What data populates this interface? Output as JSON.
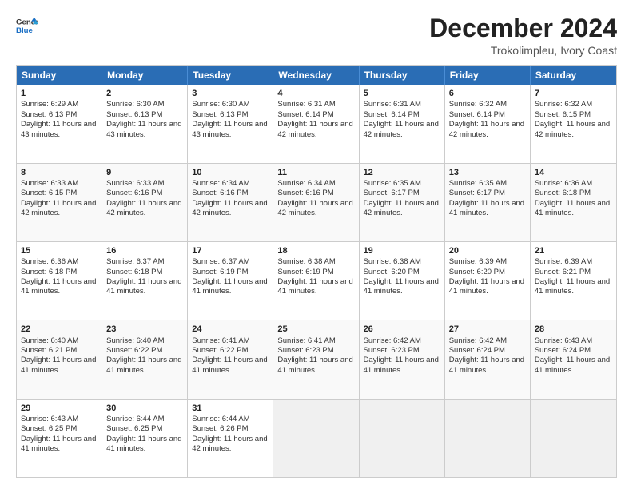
{
  "header": {
    "logo_line1": "General",
    "logo_line2": "Blue",
    "main_title": "December 2024",
    "subtitle": "Trokolimpleu, Ivory Coast"
  },
  "calendar": {
    "days_of_week": [
      "Sunday",
      "Monday",
      "Tuesday",
      "Wednesday",
      "Thursday",
      "Friday",
      "Saturday"
    ],
    "weeks": [
      [
        {
          "day": "",
          "empty": true
        },
        {
          "day": "",
          "empty": true
        },
        {
          "day": "",
          "empty": true
        },
        {
          "day": "",
          "empty": true
        },
        {
          "day": "",
          "empty": true
        },
        {
          "day": "",
          "empty": true
        },
        {
          "day": "",
          "empty": true
        }
      ],
      [
        {
          "day": "1",
          "sunrise": "Sunrise: 6:29 AM",
          "sunset": "Sunset: 6:13 PM",
          "daylight": "Daylight: 11 hours and 43 minutes."
        },
        {
          "day": "2",
          "sunrise": "Sunrise: 6:30 AM",
          "sunset": "Sunset: 6:13 PM",
          "daylight": "Daylight: 11 hours and 43 minutes."
        },
        {
          "day": "3",
          "sunrise": "Sunrise: 6:30 AM",
          "sunset": "Sunset: 6:13 PM",
          "daylight": "Daylight: 11 hours and 43 minutes."
        },
        {
          "day": "4",
          "sunrise": "Sunrise: 6:31 AM",
          "sunset": "Sunset: 6:14 PM",
          "daylight": "Daylight: 11 hours and 42 minutes."
        },
        {
          "day": "5",
          "sunrise": "Sunrise: 6:31 AM",
          "sunset": "Sunset: 6:14 PM",
          "daylight": "Daylight: 11 hours and 42 minutes."
        },
        {
          "day": "6",
          "sunrise": "Sunrise: 6:32 AM",
          "sunset": "Sunset: 6:14 PM",
          "daylight": "Daylight: 11 hours and 42 minutes."
        },
        {
          "day": "7",
          "sunrise": "Sunrise: 6:32 AM",
          "sunset": "Sunset: 6:15 PM",
          "daylight": "Daylight: 11 hours and 42 minutes."
        }
      ],
      [
        {
          "day": "8",
          "sunrise": "Sunrise: 6:33 AM",
          "sunset": "Sunset: 6:15 PM",
          "daylight": "Daylight: 11 hours and 42 minutes."
        },
        {
          "day": "9",
          "sunrise": "Sunrise: 6:33 AM",
          "sunset": "Sunset: 6:16 PM",
          "daylight": "Daylight: 11 hours and 42 minutes."
        },
        {
          "day": "10",
          "sunrise": "Sunrise: 6:34 AM",
          "sunset": "Sunset: 6:16 PM",
          "daylight": "Daylight: 11 hours and 42 minutes."
        },
        {
          "day": "11",
          "sunrise": "Sunrise: 6:34 AM",
          "sunset": "Sunset: 6:16 PM",
          "daylight": "Daylight: 11 hours and 42 minutes."
        },
        {
          "day": "12",
          "sunrise": "Sunrise: 6:35 AM",
          "sunset": "Sunset: 6:17 PM",
          "daylight": "Daylight: 11 hours and 42 minutes."
        },
        {
          "day": "13",
          "sunrise": "Sunrise: 6:35 AM",
          "sunset": "Sunset: 6:17 PM",
          "daylight": "Daylight: 11 hours and 41 minutes."
        },
        {
          "day": "14",
          "sunrise": "Sunrise: 6:36 AM",
          "sunset": "Sunset: 6:18 PM",
          "daylight": "Daylight: 11 hours and 41 minutes."
        }
      ],
      [
        {
          "day": "15",
          "sunrise": "Sunrise: 6:36 AM",
          "sunset": "Sunset: 6:18 PM",
          "daylight": "Daylight: 11 hours and 41 minutes."
        },
        {
          "day": "16",
          "sunrise": "Sunrise: 6:37 AM",
          "sunset": "Sunset: 6:18 PM",
          "daylight": "Daylight: 11 hours and 41 minutes."
        },
        {
          "day": "17",
          "sunrise": "Sunrise: 6:37 AM",
          "sunset": "Sunset: 6:19 PM",
          "daylight": "Daylight: 11 hours and 41 minutes."
        },
        {
          "day": "18",
          "sunrise": "Sunrise: 6:38 AM",
          "sunset": "Sunset: 6:19 PM",
          "daylight": "Daylight: 11 hours and 41 minutes."
        },
        {
          "day": "19",
          "sunrise": "Sunrise: 6:38 AM",
          "sunset": "Sunset: 6:20 PM",
          "daylight": "Daylight: 11 hours and 41 minutes."
        },
        {
          "day": "20",
          "sunrise": "Sunrise: 6:39 AM",
          "sunset": "Sunset: 6:20 PM",
          "daylight": "Daylight: 11 hours and 41 minutes."
        },
        {
          "day": "21",
          "sunrise": "Sunrise: 6:39 AM",
          "sunset": "Sunset: 6:21 PM",
          "daylight": "Daylight: 11 hours and 41 minutes."
        }
      ],
      [
        {
          "day": "22",
          "sunrise": "Sunrise: 6:40 AM",
          "sunset": "Sunset: 6:21 PM",
          "daylight": "Daylight: 11 hours and 41 minutes."
        },
        {
          "day": "23",
          "sunrise": "Sunrise: 6:40 AM",
          "sunset": "Sunset: 6:22 PM",
          "daylight": "Daylight: 11 hours and 41 minutes."
        },
        {
          "day": "24",
          "sunrise": "Sunrise: 6:41 AM",
          "sunset": "Sunset: 6:22 PM",
          "daylight": "Daylight: 11 hours and 41 minutes."
        },
        {
          "day": "25",
          "sunrise": "Sunrise: 6:41 AM",
          "sunset": "Sunset: 6:23 PM",
          "daylight": "Daylight: 11 hours and 41 minutes."
        },
        {
          "day": "26",
          "sunrise": "Sunrise: 6:42 AM",
          "sunset": "Sunset: 6:23 PM",
          "daylight": "Daylight: 11 hours and 41 minutes."
        },
        {
          "day": "27",
          "sunrise": "Sunrise: 6:42 AM",
          "sunset": "Sunset: 6:24 PM",
          "daylight": "Daylight: 11 hours and 41 minutes."
        },
        {
          "day": "28",
          "sunrise": "Sunrise: 6:43 AM",
          "sunset": "Sunset: 6:24 PM",
          "daylight": "Daylight: 11 hours and 41 minutes."
        }
      ],
      [
        {
          "day": "29",
          "sunrise": "Sunrise: 6:43 AM",
          "sunset": "Sunset: 6:25 PM",
          "daylight": "Daylight: 11 hours and 41 minutes."
        },
        {
          "day": "30",
          "sunrise": "Sunrise: 6:44 AM",
          "sunset": "Sunset: 6:25 PM",
          "daylight": "Daylight: 11 hours and 41 minutes."
        },
        {
          "day": "31",
          "sunrise": "Sunrise: 6:44 AM",
          "sunset": "Sunset: 6:26 PM",
          "daylight": "Daylight: 11 hours and 42 minutes."
        },
        {
          "day": "",
          "empty": true
        },
        {
          "day": "",
          "empty": true
        },
        {
          "day": "",
          "empty": true
        },
        {
          "day": "",
          "empty": true
        }
      ]
    ]
  }
}
